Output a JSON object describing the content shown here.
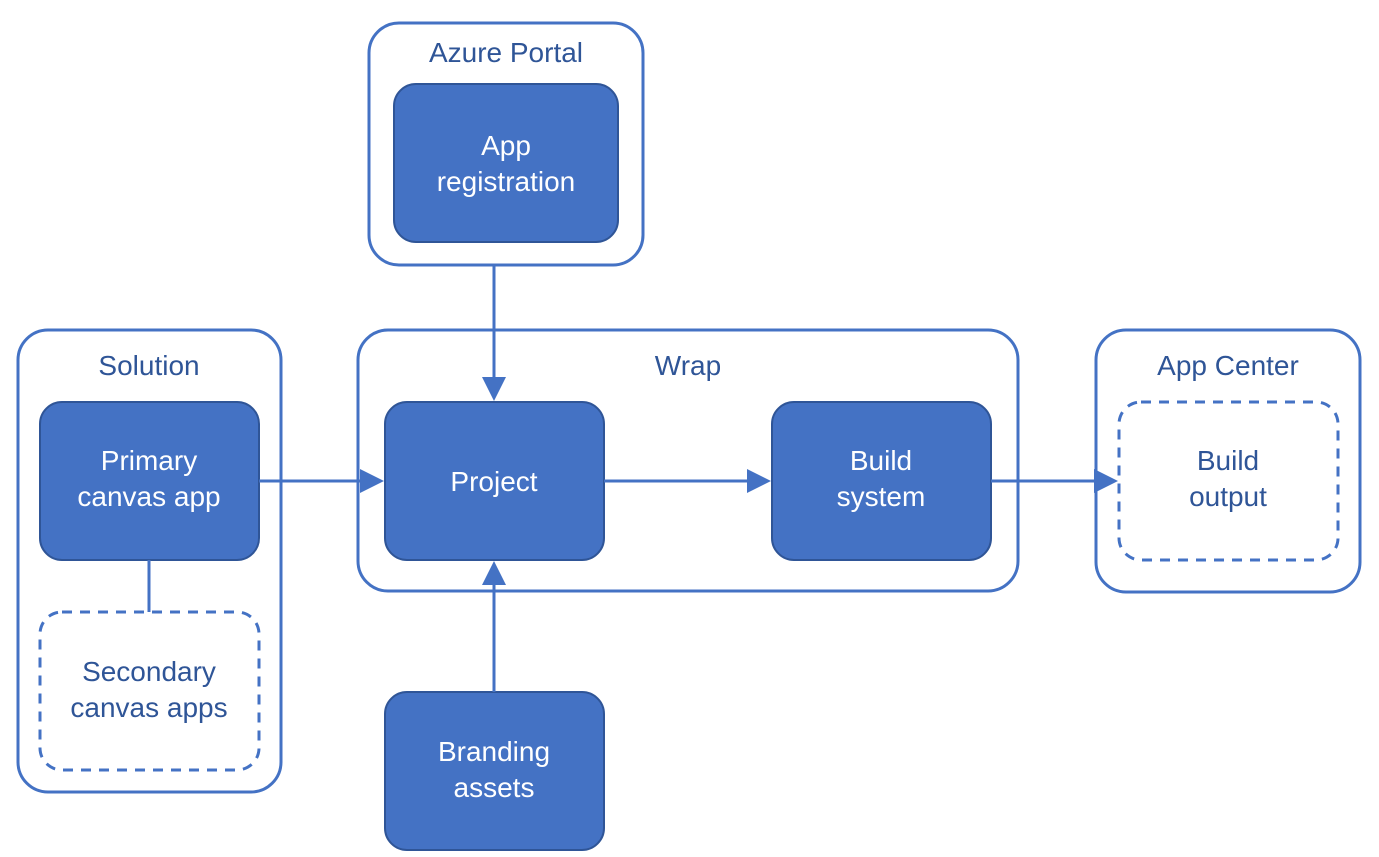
{
  "diagram": {
    "groups": {
      "azure_portal": {
        "title": "Azure Portal"
      },
      "solution": {
        "title": "Solution"
      },
      "wrap": {
        "title": "Wrap"
      },
      "app_center": {
        "title": "App Center"
      }
    },
    "nodes": {
      "app_registration": {
        "line1": "App",
        "line2": "registration"
      },
      "primary_canvas": {
        "line1": "Primary",
        "line2": "canvas app"
      },
      "secondary_canvas": {
        "line1": "Secondary",
        "line2": "canvas apps"
      },
      "project": {
        "line1": "Project"
      },
      "build_system": {
        "line1": "Build",
        "line2": "system"
      },
      "branding_assets": {
        "line1": "Branding",
        "line2": "assets"
      },
      "build_output": {
        "line1": "Build",
        "line2": "output"
      }
    },
    "colors": {
      "fill": "#4472c4",
      "stroke": "#2f5597",
      "text_light": "#ffffff",
      "text_dark": "#2f5597"
    },
    "edges": [
      {
        "from": "app_registration",
        "to": "project",
        "style": "arrow"
      },
      {
        "from": "primary_canvas",
        "to": "project",
        "style": "arrow"
      },
      {
        "from": "branding_assets",
        "to": "project",
        "style": "arrow"
      },
      {
        "from": "project",
        "to": "build_system",
        "style": "arrow"
      },
      {
        "from": "build_system",
        "to": "build_output",
        "style": "arrow"
      },
      {
        "from": "primary_canvas",
        "to": "secondary_canvas",
        "style": "line"
      }
    ]
  }
}
